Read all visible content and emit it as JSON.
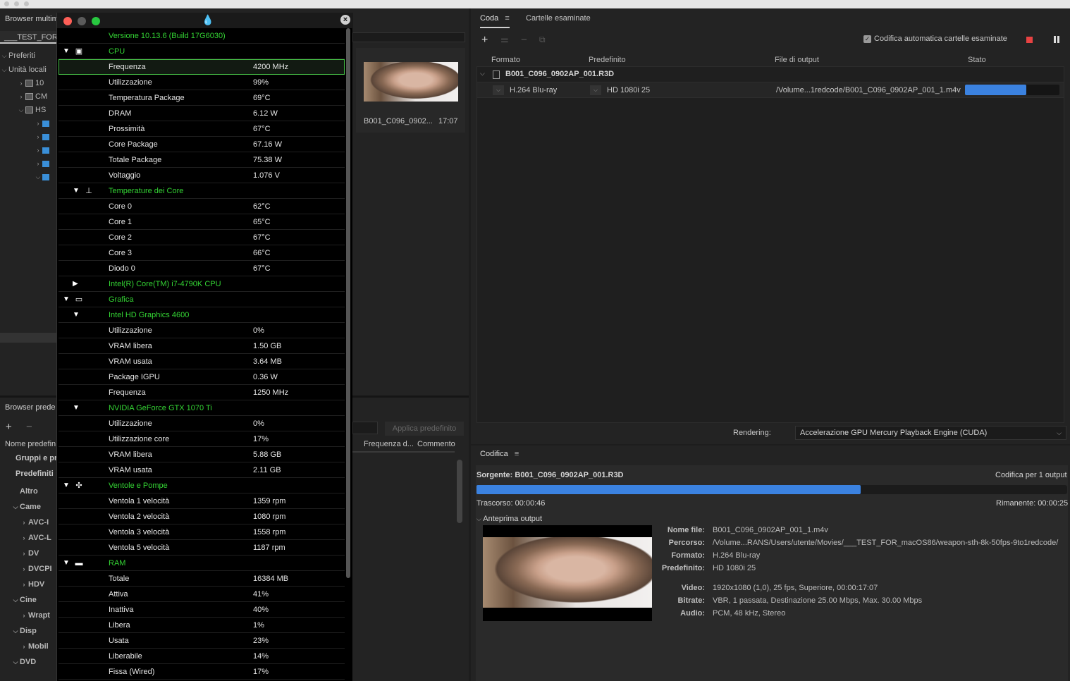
{
  "window": {
    "left_title": "Browser multimediale",
    "path_tab": "___TEST_FOR_"
  },
  "media_browser": {
    "favorites": "Preferiti",
    "local_drives": "Unità locali",
    "drives": [
      "10",
      "CM",
      "HS"
    ]
  },
  "hw": {
    "rows": [
      {
        "type": "group",
        "label": "Versione 10.13.6 (Build 17G6030)",
        "icon": "apple-icon",
        "lvl": 0
      },
      {
        "type": "group",
        "label": "CPU",
        "icon": "cpu-icon",
        "lvl": 0,
        "tri": "▼"
      },
      {
        "type": "item",
        "label": "Frequenza",
        "value": "4200 MHz",
        "selected": true
      },
      {
        "type": "item",
        "label": "Utilizzazione",
        "value": "99%"
      },
      {
        "type": "item",
        "label": "Temperatura Package",
        "value": "69°C"
      },
      {
        "type": "item",
        "label": "DRAM",
        "value": "6.12 W"
      },
      {
        "type": "item",
        "label": "Prossimità",
        "value": "67°C"
      },
      {
        "type": "item",
        "label": "Core Package",
        "value": "67.16 W"
      },
      {
        "type": "item",
        "label": "Totale Package",
        "value": "75.38 W"
      },
      {
        "type": "item",
        "label": "Voltaggio",
        "value": "1.076 V"
      },
      {
        "type": "group",
        "label": "Temperature dei Core",
        "icon": "thermometer-icon",
        "lvl": 1,
        "tri": "▼"
      },
      {
        "type": "item",
        "label": "Core 0",
        "value": "62°C"
      },
      {
        "type": "item",
        "label": "Core 1",
        "value": "65°C"
      },
      {
        "type": "item",
        "label": "Core 2",
        "value": "67°C"
      },
      {
        "type": "item",
        "label": "Core 3",
        "value": "66°C"
      },
      {
        "type": "item",
        "label": "Diodo 0",
        "value": "67°C"
      },
      {
        "type": "group",
        "label": "Intel(R) Core(TM) i7-4790K CPU",
        "lvl": 1,
        "tri": "▶"
      },
      {
        "type": "group",
        "label": "Grafica",
        "icon": "gpu-icon",
        "lvl": 0,
        "tri": "▼"
      },
      {
        "type": "group",
        "label": "Intel HD Graphics 4600",
        "lvl": 1,
        "tri": "▼"
      },
      {
        "type": "item",
        "label": "Utilizzazione",
        "value": "0%"
      },
      {
        "type": "item",
        "label": "VRAM libera",
        "value": "1.50 GB"
      },
      {
        "type": "item",
        "label": "VRAM usata",
        "value": "3.64 MB"
      },
      {
        "type": "item",
        "label": "Package IGPU",
        "value": "0.36 W"
      },
      {
        "type": "item",
        "label": "Frequenza",
        "value": "1250 MHz"
      },
      {
        "type": "group",
        "label": "NVIDIA GeForce GTX 1070 Ti",
        "lvl": 1,
        "tri": "▼"
      },
      {
        "type": "item",
        "label": "Utilizzazione",
        "value": "0%"
      },
      {
        "type": "item",
        "label": "Utilizzazione core",
        "value": "17%"
      },
      {
        "type": "item",
        "label": "VRAM libera",
        "value": "5.88 GB"
      },
      {
        "type": "item",
        "label": "VRAM usata",
        "value": "2.11 GB"
      },
      {
        "type": "group",
        "label": "Ventole e Pompe",
        "icon": "fan-icon",
        "lvl": 0,
        "tri": "▼"
      },
      {
        "type": "item",
        "label": "Ventola 1 velocità",
        "value": "1359 rpm"
      },
      {
        "type": "item",
        "label": "Ventola 2 velocità",
        "value": "1080 rpm"
      },
      {
        "type": "item",
        "label": "Ventola 3 velocità",
        "value": "1558 rpm"
      },
      {
        "type": "item",
        "label": "Ventola 5 velocità",
        "value": "1187 rpm"
      },
      {
        "type": "group",
        "label": "RAM",
        "icon": "ram-icon",
        "lvl": 0,
        "tri": "▼"
      },
      {
        "type": "item",
        "label": "Totale",
        "value": "16384 MB"
      },
      {
        "type": "item",
        "label": "Attiva",
        "value": "41%"
      },
      {
        "type": "item",
        "label": "Inattiva",
        "value": "40%"
      },
      {
        "type": "item",
        "label": "Libera",
        "value": "1%"
      },
      {
        "type": "item",
        "label": "Usata",
        "value": "23%"
      },
      {
        "type": "item",
        "label": "Liberabile",
        "value": "14%"
      },
      {
        "type": "item",
        "label": "Fissa (Wired)",
        "value": "17%"
      }
    ]
  },
  "preview": {
    "filename": "B001_C096_0902...",
    "duration": "17:07"
  },
  "presets": {
    "title": "Browser prede",
    "name_col": "Nome predefin",
    "groups": "Gruppi e pr",
    "predef": "Predefiniti",
    "apply": "Applica predefinito",
    "col_freq": "Frequenza d...",
    "col_comment": "Commento",
    "items": [
      "Altro",
      "Came",
      "AVC-I",
      "AVC-L",
      "DV",
      "DVCPI",
      "HDV",
      "Cine",
      "Wrapt",
      "Disp",
      "Mobil",
      "DVD"
    ]
  },
  "queue": {
    "tab1": "Coda",
    "tab2": "Cartelle esaminate",
    "auto": "Codifica automatica cartelle esaminate",
    "cols": [
      "Formato",
      "Predefinito",
      "File di output",
      "Stato"
    ],
    "source": "B001_C096_0902AP_001.R3D",
    "format": "H.264 Blu-ray",
    "preset": "HD 1080i 25",
    "output": "/Volume...1redcode/B001_C096_0902AP_001_1.m4v",
    "progress": 0.65
  },
  "rendering": {
    "label": "Rendering:",
    "value": "Accelerazione GPU Mercury Playback Engine (CUDA)"
  },
  "encoding": {
    "tab": "Codifica",
    "source": "Sorgente: B001_C096_0902AP_001.R3D",
    "outputs": "Codifica per 1 output",
    "elapsed": "Trascorso: 00:00:46",
    "remaining": "Rimanente: 00:00:25",
    "progress": 0.65,
    "preview_label": "Anteprima output",
    "details": [
      {
        "k": "Nome file:",
        "v": "B001_C096_0902AP_001_1.m4v"
      },
      {
        "k": "Percorso:",
        "v": "/Volume...RANS/Users/utente/Movies/___TEST_FOR_macOS86/weapon-sth-8k-50fps-9to1redcode/"
      },
      {
        "k": "Formato:",
        "v": "H.264 Blu-ray"
      },
      {
        "k": "Predefinito:",
        "v": "HD 1080i 25"
      },
      {
        "k": "Video:",
        "v": "1920x1080 (1,0), 25 fps, Superiore, 00:00:17:07"
      },
      {
        "k": "Bitrate:",
        "v": "VBR, 1 passata, Destinazione 25.00 Mbps, Max. 30.00 Mbps"
      },
      {
        "k": "Audio:",
        "v": "PCM, 48 kHz, Stereo"
      }
    ]
  }
}
